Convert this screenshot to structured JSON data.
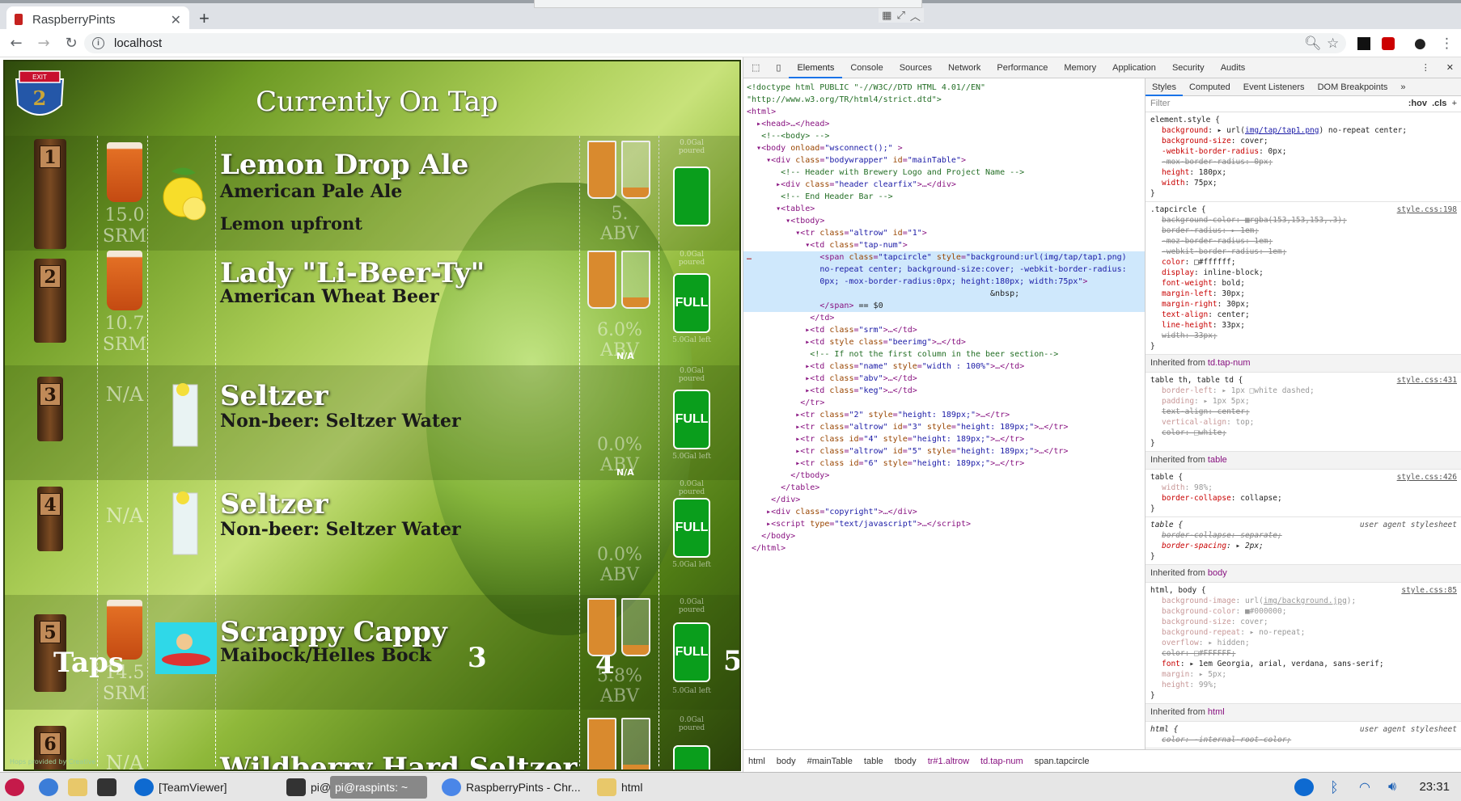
{
  "browser": {
    "tab_title": "RaspberryPints",
    "new_tab": "+",
    "url": "localhost"
  },
  "page": {
    "title": "Currently On Tap",
    "exit_sign": "EXIT",
    "exit_num": "2",
    "rows": [
      {
        "tap": "1",
        "srm": "15.0",
        "srm_unit": "SRM",
        "name": "Lemon Drop Ale",
        "style": "American Pale Ale",
        "note": "Lemon upfront",
        "abv": "5.",
        "abv_unit": "ABV",
        "keg": "",
        "poured": "0.0Gal poured",
        "left": ""
      },
      {
        "tap": "2",
        "srm": "10.7",
        "srm_unit": "SRM",
        "name": "Lady \"Li-Beer-Ty\"",
        "style": "American Wheat Beer",
        "note": "",
        "abv": "6.0%",
        "abv_unit": "ABV",
        "keg": "FULL",
        "poured": "0.0Gal poured",
        "left": "5.0Gal left"
      },
      {
        "tap": "3",
        "srm": "N/A",
        "srm_unit": "",
        "name": "Seltzer",
        "style": "Non-beer: Seltzer Water",
        "note": "",
        "abv": "0.0%",
        "abv_unit": "ABV",
        "keg": "FULL",
        "poured": "0.0Gal poured",
        "left": "5.0Gal left",
        "na": "N/A"
      },
      {
        "tap": "4",
        "srm": "N/A",
        "srm_unit": "",
        "name": "Seltzer",
        "style": "Non-beer: Seltzer Water",
        "note": "",
        "abv": "0.0%",
        "abv_unit": "ABV",
        "keg": "FULL",
        "poured": "0.0Gal poured",
        "left": "5.0Gal left",
        "na": "N/A"
      },
      {
        "tap": "5",
        "srm": "14.5",
        "srm_unit": "SRM",
        "name": "Scrappy Cappy",
        "style": "Maibock/Helles Bock",
        "note": "",
        "abv": "5.8%",
        "abv_unit": "ABV",
        "keg": "FULL",
        "poured": "0.0Gal poured",
        "left": "5.0Gal left"
      },
      {
        "tap": "6",
        "srm": "N/A",
        "srm_unit": "",
        "name": "Wildberry Hard Seltzer",
        "style": "",
        "note": "",
        "abv": "",
        "abv_unit": "",
        "keg": "",
        "poured": "0.0Gal poured",
        "left": ""
      }
    ],
    "overlay": {
      "taps": "Taps",
      "n3": "3",
      "n4": "4",
      "n5": "5"
    },
    "copyright": "Hops provided by Creative"
  },
  "devtools": {
    "tabs": [
      "Elements",
      "Console",
      "Sources",
      "Network",
      "Performance",
      "Memory",
      "Application",
      "Security",
      "Audits"
    ],
    "style_tabs": [
      "Styles",
      "Computed",
      "Event Listeners",
      "DOM Breakpoints"
    ],
    "filter_placeholder": "Filter",
    "hov": ":hov",
    "cls": ".cls",
    "breadcrumbs": [
      "html",
      "body",
      "#mainTable",
      "table",
      "tbody",
      "tr#1.altrow",
      "td.tap-num",
      "span.tapcircle"
    ]
  },
  "taskbar": {
    "items": [
      "[TeamViewer]",
      "pi@",
      "pi@raspints: ~",
      "RaspberryPints - Chr...",
      "html"
    ],
    "clock": "23:31"
  }
}
